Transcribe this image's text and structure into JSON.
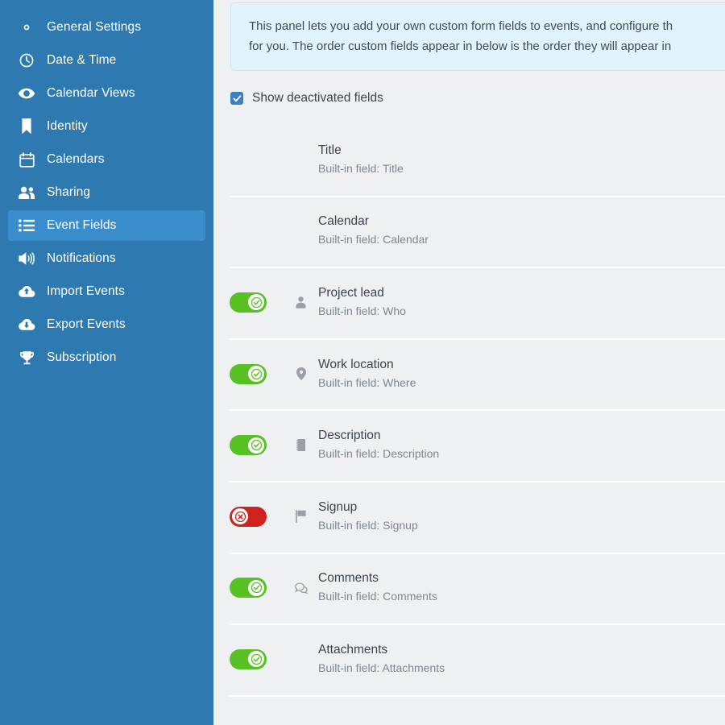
{
  "sidebar": {
    "items": [
      {
        "label": "General Settings",
        "icon": "gear-icon",
        "active": false
      },
      {
        "label": "Date & Time",
        "icon": "clock-icon",
        "active": false
      },
      {
        "label": "Calendar Views",
        "icon": "eye-icon",
        "active": false
      },
      {
        "label": "Identity",
        "icon": "bookmark-icon",
        "active": false
      },
      {
        "label": "Calendars",
        "icon": "calendar-icon",
        "active": false
      },
      {
        "label": "Sharing",
        "icon": "users-icon",
        "active": false
      },
      {
        "label": "Event Fields",
        "icon": "list-icon",
        "active": true
      },
      {
        "label": "Notifications",
        "icon": "speaker-icon",
        "active": false
      },
      {
        "label": "Import Events",
        "icon": "cloud-upload-icon",
        "active": false
      },
      {
        "label": "Export Events",
        "icon": "cloud-download-icon",
        "active": false
      },
      {
        "label": "Subscription",
        "icon": "trophy-icon",
        "active": false
      }
    ]
  },
  "info_panel": {
    "line1": "This panel lets you add your own custom form fields to events, and configure th",
    "line2": "for you. The order custom fields appear in below is the order they will appear in"
  },
  "show_deactivated": {
    "label": "Show deactivated fields",
    "checked": true
  },
  "fields": [
    {
      "name": "Title",
      "sub": "Built-in field: Title",
      "toggle": "none",
      "icon": "none"
    },
    {
      "name": "Calendar",
      "sub": "Built-in field: Calendar",
      "toggle": "none",
      "icon": "none"
    },
    {
      "name": "Project lead",
      "sub": "Built-in field: Who",
      "toggle": "on",
      "icon": "person-icon"
    },
    {
      "name": "Work location",
      "sub": "Built-in field: Where",
      "toggle": "on",
      "icon": "map-pin-icon"
    },
    {
      "name": "Description",
      "sub": "Built-in field: Description",
      "toggle": "on",
      "icon": "notepad-icon"
    },
    {
      "name": "Signup",
      "sub": "Built-in field: Signup",
      "toggle": "off",
      "icon": "flag-icon"
    },
    {
      "name": "Comments",
      "sub": "Built-in field: Comments",
      "toggle": "on",
      "icon": "speech-bubble-icon"
    },
    {
      "name": "Attachments",
      "sub": "Built-in field: Attachments",
      "toggle": "on",
      "icon": "none"
    }
  ],
  "colors": {
    "sidebar": "#2e79b0",
    "sidebar_active": "#3c8dcb",
    "content_bg": "#eff0f2",
    "info_bg": "#e2f4fb",
    "toggle_on": "#57c023",
    "toggle_off": "#d0211c",
    "checkbox": "#3b7fc4"
  }
}
